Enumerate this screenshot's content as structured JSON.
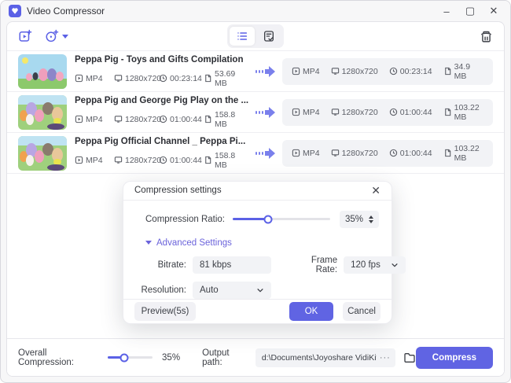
{
  "titlebar": {
    "title": "Video Compressor",
    "minimize": "–",
    "maximize": "▢",
    "close": "✕"
  },
  "videos": [
    {
      "title": "Peppa Pig - Toys and Gifts Compilation",
      "in": {
        "format": "MP4",
        "resolution": "1280x720",
        "duration": "00:23:14",
        "size": "53.69 MB"
      },
      "out": {
        "format": "MP4",
        "resolution": "1280x720",
        "duration": "00:23:14",
        "size": "34.9 MB"
      }
    },
    {
      "title": "Peppa Pig and George Pig Play on the ...",
      "in": {
        "format": "MP4",
        "resolution": "1280x720",
        "duration": "01:00:44",
        "size": "158.8 MB"
      },
      "out": {
        "format": "MP4",
        "resolution": "1280x720",
        "duration": "01:00:44",
        "size": "103.22 MB"
      }
    },
    {
      "title": "Peppa Pig Official Channel _ Peppa Pi...",
      "in": {
        "format": "MP4",
        "resolution": "1280x720",
        "duration": "01:00:44",
        "size": "158.8 MB"
      },
      "out": {
        "format": "MP4",
        "resolution": "1280x720",
        "duration": "01:00:44",
        "size": "103.22 MB"
      }
    }
  ],
  "dialog": {
    "title": "Compression settings",
    "close": "✕",
    "ratio_label": "Compression Ratio:",
    "ratio_value": "35%",
    "advanced_label": "Advanced Settings",
    "bitrate_label": "Bitrate:",
    "bitrate_value": "81 kbps",
    "framerate_label": "Frame Rate:",
    "framerate_value": "120 fps",
    "resolution_label": "Resolution:",
    "resolution_value": "Auto",
    "preview_button": "Preview(5s)",
    "ok_button": "OK",
    "cancel_button": "Cancel"
  },
  "footer": {
    "overall_label": "Overall Compression:",
    "overall_value": "35%",
    "output_label": "Output path:",
    "output_value": "d:\\Documents\\Joyoshare VidiKit\\Video",
    "more": "···",
    "compress_button": "Compress"
  },
  "colors": {
    "accent": "#5B61E6",
    "button": "#6064E3"
  }
}
